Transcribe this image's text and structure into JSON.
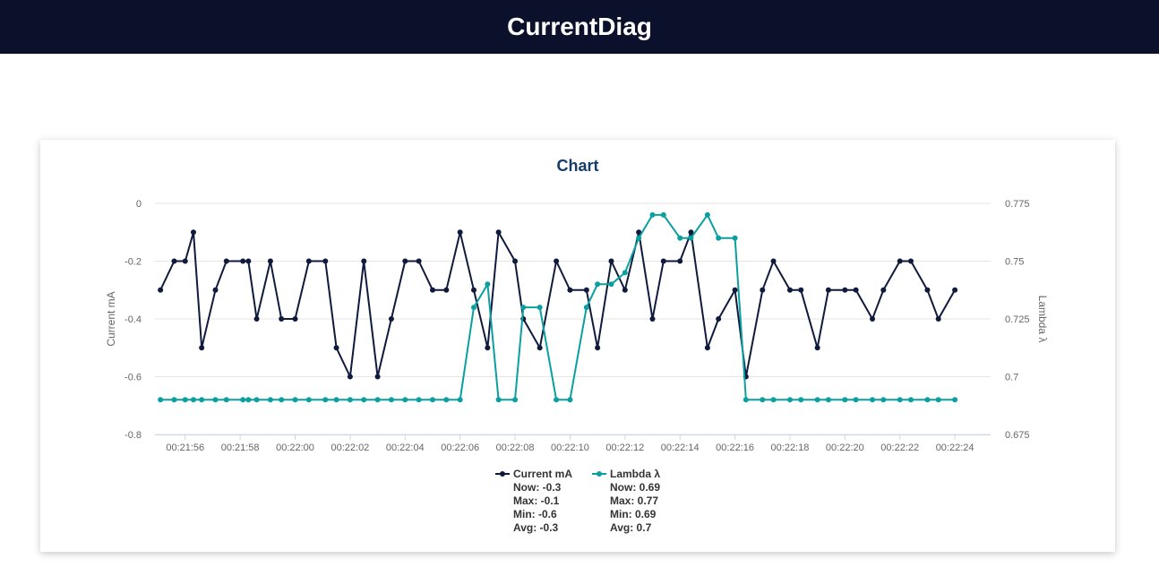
{
  "app": {
    "title": "CurrentDiag"
  },
  "chart_data": {
    "type": "line",
    "title": "Chart",
    "x_tick_labels": [
      "00:21:56",
      "00:21:58",
      "00:22:00",
      "00:22:02",
      "00:22:04",
      "00:22:06",
      "00:22:08",
      "00:22:10",
      "00:22:12",
      "00:22:14",
      "00:22:16",
      "00:22:18",
      "00:22:20",
      "00:22:22",
      "00:22:24"
    ],
    "xlim": [
      "00:21:54.9",
      "00:22:25.3"
    ],
    "y_axes": {
      "left": {
        "label": "Current mA",
        "ylim": [
          -0.8,
          0
        ],
        "ticks": [
          "0",
          "-0.2",
          "-0.4",
          "-0.6",
          "-0.8"
        ],
        "tick_values": [
          0,
          -0.2,
          -0.4,
          -0.6,
          -0.8
        ]
      },
      "right": {
        "label": "Lambda λ",
        "ylim": [
          0.675,
          0.775
        ],
        "ticks": [
          "0.775",
          "0.75",
          "0.725",
          "0.7",
          "0.675"
        ],
        "tick_values": [
          0.775,
          0.75,
          0.725,
          0.7,
          0.675
        ]
      }
    },
    "grid": true,
    "legend_position": "bottom",
    "series": [
      {
        "name": "Current mA",
        "axis": "left",
        "color": "#0f1a3d",
        "x": [
          "00:21:55.1",
          "00:21:55.6",
          "00:21:56.0",
          "00:21:56.3",
          "00:21:56.6",
          "00:21:57.1",
          "00:21:57.5",
          "00:21:58.1",
          "00:21:58.3",
          "00:21:58.6",
          "00:21:59.1",
          "00:21:59.5",
          "00:22:00.0",
          "00:22:00.5",
          "00:22:01.1",
          "00:22:01.5",
          "00:22:02.0",
          "00:22:02.5",
          "00:22:03.0",
          "00:22:03.5",
          "00:22:04.0",
          "00:22:04.5",
          "00:22:05.0",
          "00:22:05.5",
          "00:22:06.0",
          "00:22:06.5",
          "00:22:07.0",
          "00:22:07.4",
          "00:22:08.0",
          "00:22:08.3",
          "00:22:08.9",
          "00:22:09.5",
          "00:22:10.0",
          "00:22:10.6",
          "00:22:11.0",
          "00:22:11.5",
          "00:22:12.0",
          "00:22:12.5",
          "00:22:13.0",
          "00:22:13.4",
          "00:22:14.0",
          "00:22:14.4",
          "00:22:15.0",
          "00:22:15.4",
          "00:22:16.0",
          "00:22:16.4",
          "00:22:17.0",
          "00:22:17.4",
          "00:22:18.0",
          "00:22:18.4",
          "00:22:19.0",
          "00:22:19.4",
          "00:22:20.0",
          "00:22:20.4",
          "00:22:21.0",
          "00:22:21.4",
          "00:22:22.0",
          "00:22:22.4",
          "00:22:23.0",
          "00:22:23.4",
          "00:22:24.0"
        ],
        "values": [
          -0.3,
          -0.2,
          -0.2,
          -0.1,
          -0.5,
          -0.3,
          -0.2,
          -0.2,
          -0.2,
          -0.4,
          -0.2,
          -0.4,
          -0.4,
          -0.2,
          -0.2,
          -0.5,
          -0.6,
          -0.2,
          -0.6,
          -0.4,
          -0.2,
          -0.2,
          -0.3,
          -0.3,
          -0.1,
          -0.3,
          -0.5,
          -0.1,
          -0.2,
          -0.4,
          -0.5,
          -0.2,
          -0.3,
          -0.3,
          -0.5,
          -0.2,
          -0.3,
          -0.1,
          -0.4,
          -0.2,
          -0.2,
          -0.1,
          -0.5,
          -0.4,
          -0.3,
          -0.6,
          -0.3,
          -0.2,
          -0.3,
          -0.3,
          -0.5,
          -0.3,
          -0.3,
          -0.3,
          -0.4,
          -0.3,
          -0.2,
          -0.2,
          -0.3,
          -0.4,
          -0.3
        ]
      },
      {
        "name": "Lambda λ",
        "axis": "right",
        "color": "#0aa0a0",
        "x": [
          "00:21:55.1",
          "00:21:55.6",
          "00:21:56.0",
          "00:21:56.3",
          "00:21:56.6",
          "00:21:57.1",
          "00:21:57.5",
          "00:21:58.1",
          "00:21:58.3",
          "00:21:58.6",
          "00:21:59.1",
          "00:21:59.5",
          "00:22:00.0",
          "00:22:00.5",
          "00:22:01.1",
          "00:22:01.5",
          "00:22:02.0",
          "00:22:02.5",
          "00:22:03.0",
          "00:22:03.5",
          "00:22:04.0",
          "00:22:04.5",
          "00:22:05.0",
          "00:22:05.5",
          "00:22:06.0",
          "00:22:06.5",
          "00:22:07.0",
          "00:22:07.4",
          "00:22:08.0",
          "00:22:08.3",
          "00:22:08.9",
          "00:22:09.5",
          "00:22:10.0",
          "00:22:10.6",
          "00:22:11.0",
          "00:22:11.5",
          "00:22:12.0",
          "00:22:12.5",
          "00:22:13.0",
          "00:22:13.4",
          "00:22:14.0",
          "00:22:14.4",
          "00:22:15.0",
          "00:22:15.4",
          "00:22:16.0",
          "00:22:16.4",
          "00:22:17.0",
          "00:22:17.4",
          "00:22:18.0",
          "00:22:18.4",
          "00:22:19.0",
          "00:22:19.4",
          "00:22:20.0",
          "00:22:20.4",
          "00:22:21.0",
          "00:22:21.4",
          "00:22:22.0",
          "00:22:22.4",
          "00:22:23.0",
          "00:22:23.4",
          "00:22:24.0"
        ],
        "values": [
          0.69,
          0.69,
          0.69,
          0.69,
          0.69,
          0.69,
          0.69,
          0.69,
          0.69,
          0.69,
          0.69,
          0.69,
          0.69,
          0.69,
          0.69,
          0.69,
          0.69,
          0.69,
          0.69,
          0.69,
          0.69,
          0.69,
          0.69,
          0.69,
          0.69,
          0.73,
          0.74,
          0.69,
          0.69,
          0.73,
          0.73,
          0.69,
          0.69,
          0.73,
          0.74,
          0.74,
          0.745,
          0.76,
          0.77,
          0.77,
          0.76,
          0.76,
          0.77,
          0.76,
          0.76,
          0.69,
          0.69,
          0.69,
          0.69,
          0.69,
          0.69,
          0.69,
          0.69,
          0.69,
          0.69,
          0.69,
          0.69,
          0.69,
          0.69,
          0.69,
          0.69
        ]
      }
    ],
    "legend": [
      {
        "name": "Current mA",
        "now": "Now: -0.3",
        "max": "Max: -0.1",
        "min": "Min: -0.6",
        "avg": "Avg: -0.3"
      },
      {
        "name": "Lambda λ",
        "now": "Now: 0.69",
        "max": "Max: 0.77",
        "min": "Min: 0.69",
        "avg": "Avg: 0.7"
      }
    ]
  }
}
